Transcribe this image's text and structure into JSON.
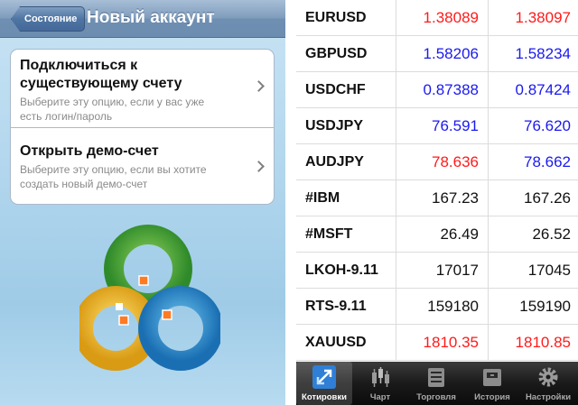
{
  "left_screen": {
    "navbar": {
      "back_label": "Состояние",
      "title": "Новый аккаунт"
    },
    "options": [
      {
        "title_line1": "Подключиться к",
        "title_line2": "существующему счету",
        "desc_line1": "Выберите эту опцию, если у вас уже",
        "desc_line2": "есть логин/пароль"
      },
      {
        "title_line1": "Открыть демо-счет",
        "desc_line1": "Выберите эту опцию, если вы хотите",
        "desc_line2": "создать новый демо-счет"
      }
    ],
    "logo_icon": "metatrader-logo-icon"
  },
  "right_screen": {
    "colors": {
      "up": "#ff1a1a",
      "down": "#1a1aee",
      "neutral": "#111111"
    },
    "quotes": [
      {
        "symbol": "EURUSD",
        "bid": "1.38089",
        "ask": "1.38097",
        "bid_color": "up",
        "ask_color": "up"
      },
      {
        "symbol": "GBPUSD",
        "bid": "1.58206",
        "ask": "1.58234",
        "bid_color": "down",
        "ask_color": "down"
      },
      {
        "symbol": "USDCHF",
        "bid": "0.87388",
        "ask": "0.87424",
        "bid_color": "down",
        "ask_color": "down"
      },
      {
        "symbol": "USDJPY",
        "bid": "76.591",
        "ask": "76.620",
        "bid_color": "down",
        "ask_color": "down"
      },
      {
        "symbol": "AUDJPY",
        "bid": "78.636",
        "ask": "78.662",
        "bid_color": "up",
        "ask_color": "down"
      },
      {
        "symbol": "#IBM",
        "bid": "167.23",
        "ask": "167.26",
        "bid_color": "neutral",
        "ask_color": "neutral"
      },
      {
        "symbol": "#MSFT",
        "bid": "26.49",
        "ask": "26.52",
        "bid_color": "neutral",
        "ask_color": "neutral"
      },
      {
        "symbol": "LKOH-9.11",
        "bid": "17017",
        "ask": "17045",
        "bid_color": "neutral",
        "ask_color": "neutral"
      },
      {
        "symbol": "RTS-9.11",
        "bid": "159180",
        "ask": "159190",
        "bid_color": "neutral",
        "ask_color": "neutral"
      },
      {
        "symbol": "XAUUSD",
        "bid": "1810.35",
        "ask": "1810.85",
        "bid_color": "up",
        "ask_color": "up"
      }
    ],
    "tabbar": [
      {
        "label": "Котировки",
        "icon": "quotes-arrows-icon",
        "selected": true
      },
      {
        "label": "Чарт",
        "icon": "candlestick-chart-icon",
        "selected": false
      },
      {
        "label": "Торговля",
        "icon": "trade-list-icon",
        "selected": false
      },
      {
        "label": "История",
        "icon": "history-box-icon",
        "selected": false
      },
      {
        "label": "Настройки",
        "icon": "settings-gear-icon",
        "selected": false
      }
    ]
  }
}
